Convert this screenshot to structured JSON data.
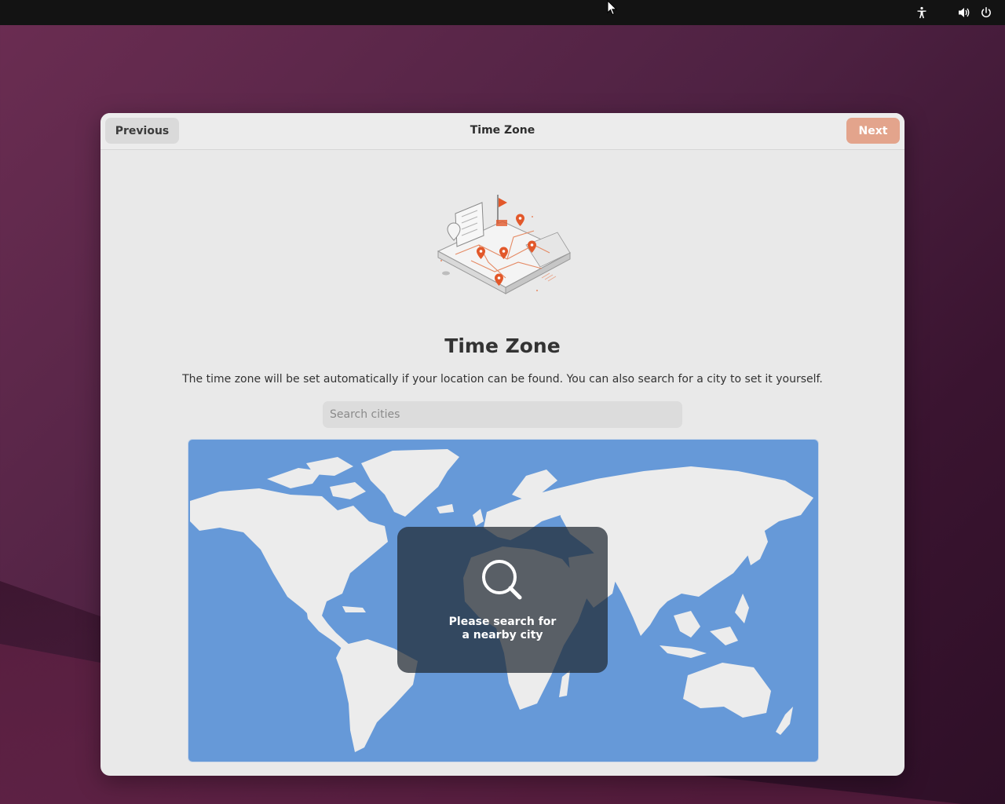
{
  "topbar": {
    "icons": [
      "accessibility-icon",
      "volume-icon",
      "power-icon"
    ]
  },
  "window": {
    "header": {
      "title": "Time Zone",
      "previous_label": "Previous",
      "next_label": "Next"
    },
    "heading": "Time Zone",
    "description": "The time zone will be set automatically if your location can be found. You can also search for a city to set it yourself.",
    "search": {
      "placeholder": "Search cities",
      "value": ""
    },
    "map": {
      "overlay_line1": "Please search for",
      "overlay_line2": "a nearby city",
      "icon": "search-icon"
    }
  },
  "colors": {
    "accent_next": "#e3a48c",
    "map_ocean": "#6699d8",
    "land": "#ececec",
    "pin": "#e2582a"
  }
}
